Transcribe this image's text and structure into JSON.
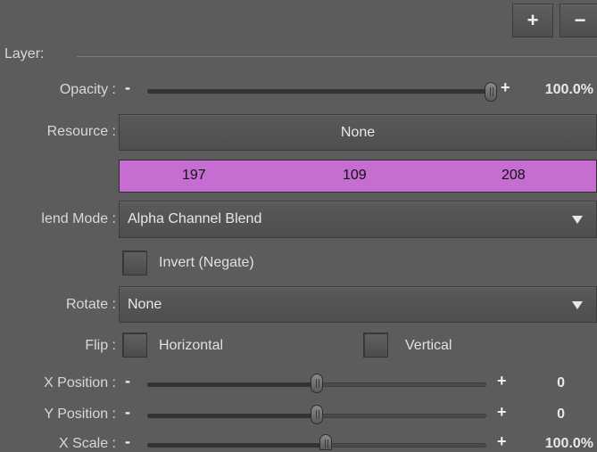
{
  "header": {
    "add_label": "+",
    "remove_label": "−"
  },
  "layer": {
    "title": "Layer:"
  },
  "opacity": {
    "label": "Opacity :",
    "value": "100.0%",
    "fraction": 1.0,
    "minus": "-",
    "plus": "+"
  },
  "resource": {
    "label": "Resource :",
    "value": "None"
  },
  "color": {
    "r": "197",
    "g": "109",
    "b": "208",
    "swatch": "#c56dd0"
  },
  "blend_mode": {
    "label": "lend Mode :",
    "value": "Alpha Channel Blend"
  },
  "invert": {
    "label": "Invert (Negate)",
    "checked": false
  },
  "rotate": {
    "label": "Rotate :",
    "value": "None"
  },
  "flip": {
    "label": "Flip :",
    "horizontal": "Horizontal",
    "vertical": "Vertical"
  },
  "x_position": {
    "label": "X Position :",
    "value": "0",
    "fraction": 0.5,
    "minus": "-",
    "plus": "+"
  },
  "y_position": {
    "label": "Y Position :",
    "value": "0",
    "fraction": 0.5,
    "minus": "-",
    "plus": "+"
  },
  "x_scale": {
    "label": "X Scale :",
    "value": "100.0%",
    "fraction": 0.5,
    "minus": "-",
    "plus": "+"
  }
}
